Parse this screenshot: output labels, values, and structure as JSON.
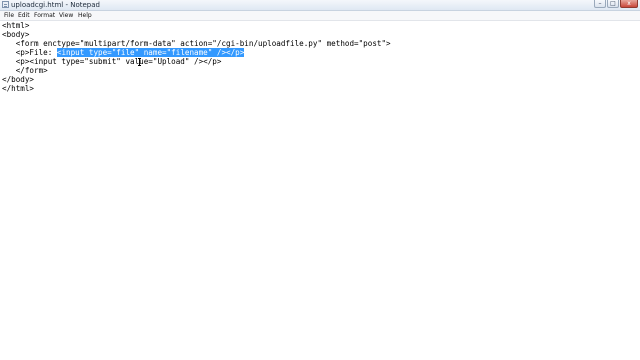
{
  "window": {
    "title": "uploadcgi.html - Notepad",
    "minimize_glyph": "–",
    "maximize_glyph": "□",
    "close_glyph": "x"
  },
  "menu": {
    "file": "File",
    "edit": "Edit",
    "format": "Format",
    "view": "View",
    "help": "Help"
  },
  "editor": {
    "selection_color": "#3399ff",
    "lines": {
      "l1": "<html>",
      "l2": "<body>",
      "l3": "   <form enctype=\"multipart/form-data\" action=\"/cgi-bin/uploadfile.py\" method=\"post\">",
      "l4_prefix": "   <p>File: ",
      "l4_selected": "<input type=\"file\" name=\"filename\" /></p>",
      "l5": "   <p><input type=\"submit\" value=\"Upload\" /></p>",
      "l6": "   </form>",
      "l7": "</body>",
      "l8": "</html>"
    }
  }
}
